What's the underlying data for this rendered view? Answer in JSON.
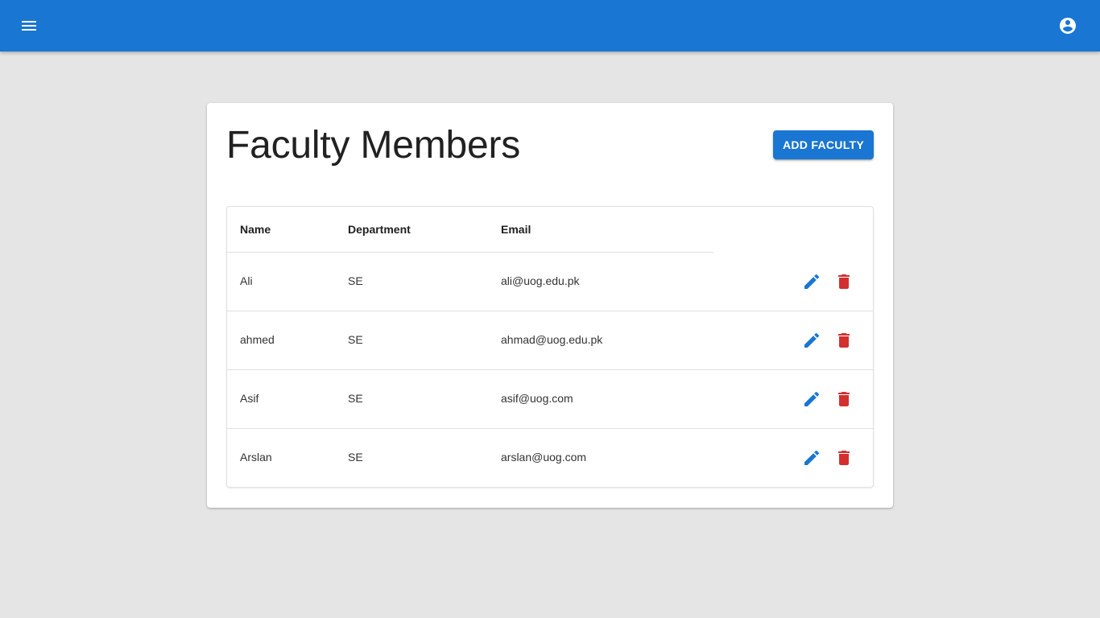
{
  "appbar": {
    "menu_icon": "menu-icon",
    "account_icon": "account-circle-icon",
    "color": "#1976d2"
  },
  "main": {
    "title": "Faculty Members",
    "add_button_label": "ADD FACULTY",
    "table": {
      "columns": [
        "Name",
        "Department",
        "Email"
      ],
      "rows": [
        {
          "name": "Ali",
          "department": "SE",
          "email": "ali@uog.edu.pk"
        },
        {
          "name": "ahmed",
          "department": "SE",
          "email": "ahmad@uog.edu.pk"
        },
        {
          "name": "Asif",
          "department": "SE",
          "email": "asif@uog.com"
        },
        {
          "name": "Arslan",
          "department": "SE",
          "email": "arslan@uog.com"
        }
      ],
      "row_actions": {
        "edit_icon": "pencil-icon",
        "delete_icon": "trash-icon",
        "edit_color": "#1976d2",
        "delete_color": "#d32f2f"
      }
    }
  }
}
